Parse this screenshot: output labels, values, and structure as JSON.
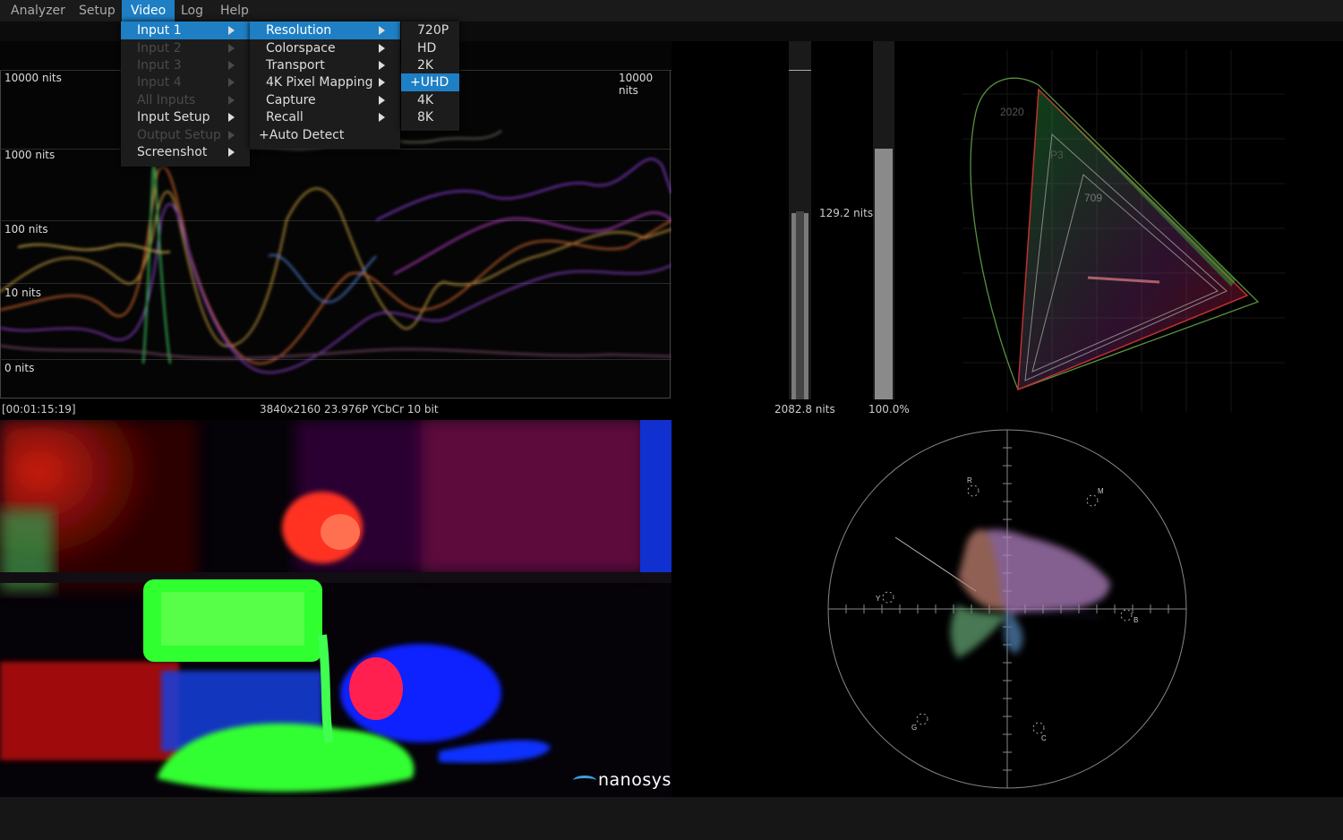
{
  "menubar": {
    "items": [
      {
        "label": "Analyzer"
      },
      {
        "label": "Setup"
      },
      {
        "label": "Video"
      },
      {
        "label": "Log"
      },
      {
        "label": "Help"
      }
    ]
  },
  "video_menu": {
    "items": [
      {
        "label": "Input 1",
        "enabled": true,
        "highlighted": true
      },
      {
        "label": "Input 2",
        "enabled": false
      },
      {
        "label": "Input 3",
        "enabled": false
      },
      {
        "label": "Input 4",
        "enabled": false
      },
      {
        "label": "All Inputs",
        "enabled": false
      },
      {
        "label": "Input Setup",
        "enabled": true
      },
      {
        "label": "Output Setup",
        "enabled": false
      },
      {
        "label": "Screenshot",
        "enabled": true
      }
    ]
  },
  "input_submenu": {
    "items": [
      {
        "label": "Resolution",
        "highlighted": true
      },
      {
        "label": "Colorspace"
      },
      {
        "label": "Transport"
      },
      {
        "label": "4K Pixel Mapping"
      },
      {
        "label": "Capture"
      },
      {
        "label": "Recall"
      },
      {
        "label": "+Auto Detect"
      }
    ]
  },
  "resolution_submenu": {
    "items": [
      {
        "label": "720P"
      },
      {
        "label": "HD"
      },
      {
        "label": "2K"
      },
      {
        "label": "+UHD",
        "highlighted": true
      },
      {
        "label": "4K"
      },
      {
        "label": "8K"
      }
    ]
  },
  "waveform": {
    "labels": {
      "l10000_left": "10000 nits",
      "l10000_right": "10000 nits",
      "l1000": "1000 nits",
      "l100": "100 nits",
      "l10": "10 nits",
      "l0": "0 nits"
    }
  },
  "status": {
    "timecode": "[00:01:15:19]",
    "format": "3840x2160 23.976P YCbCr 10 bit"
  },
  "meters": {
    "left_value": "2082.8 nits",
    "center_value": "129.2 nits",
    "right_value": "100.0%",
    "left_fill": 0.52,
    "right_fill": 0.7
  },
  "cie": {
    "labels": {
      "g2020": "2020",
      "p3": "P3",
      "r709": "709"
    }
  },
  "vectorscope": {
    "targets": {
      "r": "R",
      "m": "M",
      "y": "Y",
      "b": "B",
      "g": "G",
      "c": "C"
    }
  },
  "logo": {
    "text": "nanosys"
  },
  "colors": {
    "accent": "#1e7fc4",
    "background": "#000000"
  }
}
